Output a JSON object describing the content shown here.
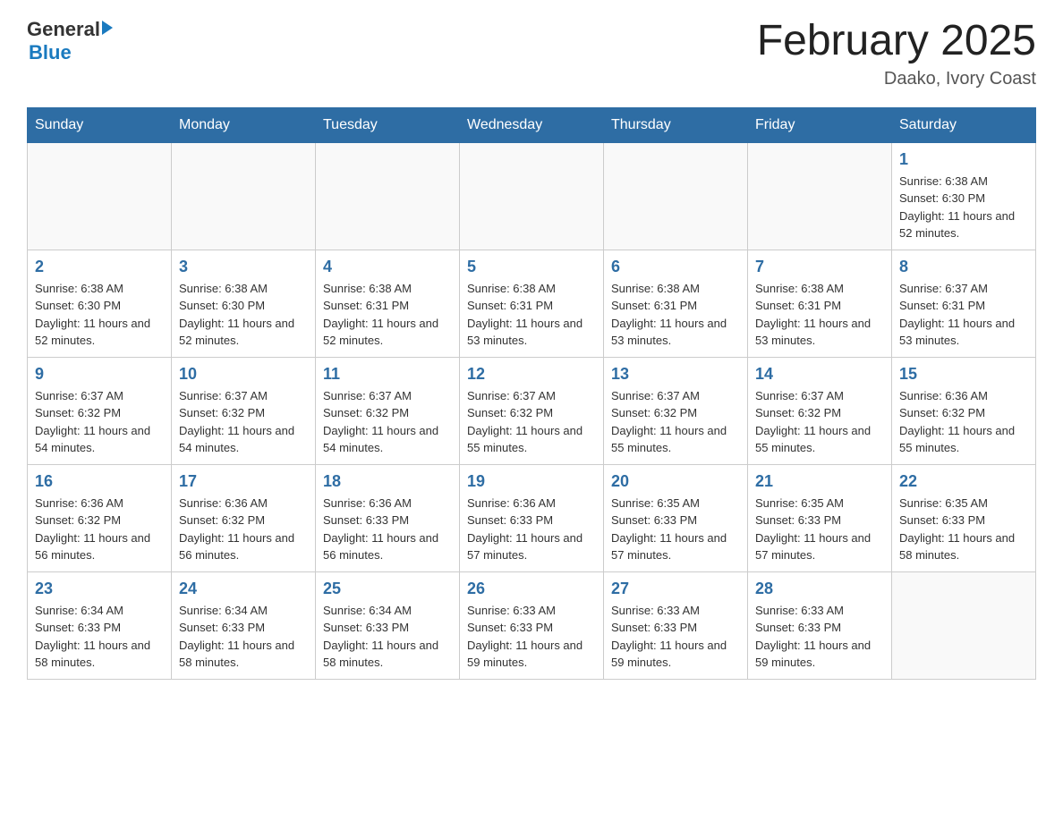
{
  "header": {
    "logo_general": "General",
    "logo_blue": "Blue",
    "month_title": "February 2025",
    "location": "Daako, Ivory Coast"
  },
  "days_of_week": [
    "Sunday",
    "Monday",
    "Tuesday",
    "Wednesday",
    "Thursday",
    "Friday",
    "Saturday"
  ],
  "weeks": [
    [
      {
        "day": "",
        "info": ""
      },
      {
        "day": "",
        "info": ""
      },
      {
        "day": "",
        "info": ""
      },
      {
        "day": "",
        "info": ""
      },
      {
        "day": "",
        "info": ""
      },
      {
        "day": "",
        "info": ""
      },
      {
        "day": "1",
        "info": "Sunrise: 6:38 AM\nSunset: 6:30 PM\nDaylight: 11 hours and 52 minutes."
      }
    ],
    [
      {
        "day": "2",
        "info": "Sunrise: 6:38 AM\nSunset: 6:30 PM\nDaylight: 11 hours and 52 minutes."
      },
      {
        "day": "3",
        "info": "Sunrise: 6:38 AM\nSunset: 6:30 PM\nDaylight: 11 hours and 52 minutes."
      },
      {
        "day": "4",
        "info": "Sunrise: 6:38 AM\nSunset: 6:31 PM\nDaylight: 11 hours and 52 minutes."
      },
      {
        "day": "5",
        "info": "Sunrise: 6:38 AM\nSunset: 6:31 PM\nDaylight: 11 hours and 53 minutes."
      },
      {
        "day": "6",
        "info": "Sunrise: 6:38 AM\nSunset: 6:31 PM\nDaylight: 11 hours and 53 minutes."
      },
      {
        "day": "7",
        "info": "Sunrise: 6:38 AM\nSunset: 6:31 PM\nDaylight: 11 hours and 53 minutes."
      },
      {
        "day": "8",
        "info": "Sunrise: 6:37 AM\nSunset: 6:31 PM\nDaylight: 11 hours and 53 minutes."
      }
    ],
    [
      {
        "day": "9",
        "info": "Sunrise: 6:37 AM\nSunset: 6:32 PM\nDaylight: 11 hours and 54 minutes."
      },
      {
        "day": "10",
        "info": "Sunrise: 6:37 AM\nSunset: 6:32 PM\nDaylight: 11 hours and 54 minutes."
      },
      {
        "day": "11",
        "info": "Sunrise: 6:37 AM\nSunset: 6:32 PM\nDaylight: 11 hours and 54 minutes."
      },
      {
        "day": "12",
        "info": "Sunrise: 6:37 AM\nSunset: 6:32 PM\nDaylight: 11 hours and 55 minutes."
      },
      {
        "day": "13",
        "info": "Sunrise: 6:37 AM\nSunset: 6:32 PM\nDaylight: 11 hours and 55 minutes."
      },
      {
        "day": "14",
        "info": "Sunrise: 6:37 AM\nSunset: 6:32 PM\nDaylight: 11 hours and 55 minutes."
      },
      {
        "day": "15",
        "info": "Sunrise: 6:36 AM\nSunset: 6:32 PM\nDaylight: 11 hours and 55 minutes."
      }
    ],
    [
      {
        "day": "16",
        "info": "Sunrise: 6:36 AM\nSunset: 6:32 PM\nDaylight: 11 hours and 56 minutes."
      },
      {
        "day": "17",
        "info": "Sunrise: 6:36 AM\nSunset: 6:32 PM\nDaylight: 11 hours and 56 minutes."
      },
      {
        "day": "18",
        "info": "Sunrise: 6:36 AM\nSunset: 6:33 PM\nDaylight: 11 hours and 56 minutes."
      },
      {
        "day": "19",
        "info": "Sunrise: 6:36 AM\nSunset: 6:33 PM\nDaylight: 11 hours and 57 minutes."
      },
      {
        "day": "20",
        "info": "Sunrise: 6:35 AM\nSunset: 6:33 PM\nDaylight: 11 hours and 57 minutes."
      },
      {
        "day": "21",
        "info": "Sunrise: 6:35 AM\nSunset: 6:33 PM\nDaylight: 11 hours and 57 minutes."
      },
      {
        "day": "22",
        "info": "Sunrise: 6:35 AM\nSunset: 6:33 PM\nDaylight: 11 hours and 58 minutes."
      }
    ],
    [
      {
        "day": "23",
        "info": "Sunrise: 6:34 AM\nSunset: 6:33 PM\nDaylight: 11 hours and 58 minutes."
      },
      {
        "day": "24",
        "info": "Sunrise: 6:34 AM\nSunset: 6:33 PM\nDaylight: 11 hours and 58 minutes."
      },
      {
        "day": "25",
        "info": "Sunrise: 6:34 AM\nSunset: 6:33 PM\nDaylight: 11 hours and 58 minutes."
      },
      {
        "day": "26",
        "info": "Sunrise: 6:33 AM\nSunset: 6:33 PM\nDaylight: 11 hours and 59 minutes."
      },
      {
        "day": "27",
        "info": "Sunrise: 6:33 AM\nSunset: 6:33 PM\nDaylight: 11 hours and 59 minutes."
      },
      {
        "day": "28",
        "info": "Sunrise: 6:33 AM\nSunset: 6:33 PM\nDaylight: 11 hours and 59 minutes."
      },
      {
        "day": "",
        "info": ""
      }
    ]
  ]
}
